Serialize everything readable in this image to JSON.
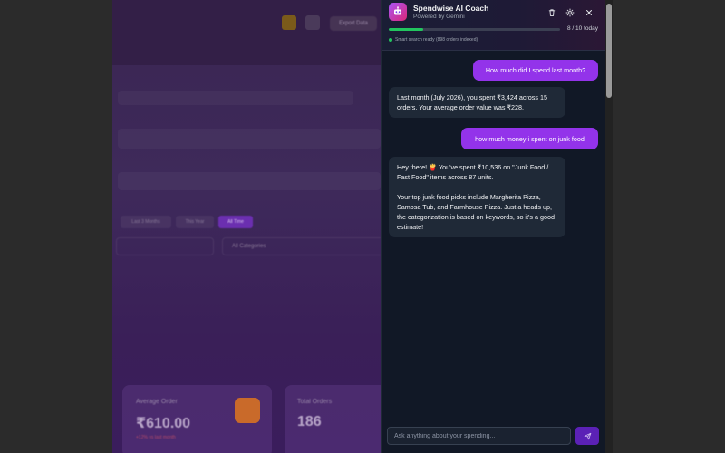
{
  "background": {
    "topbar_button_label": "Export Data",
    "tabs": [
      "Last 3 Months",
      "This Year",
      "All Time"
    ],
    "filter_value": "All Categories",
    "cards": [
      {
        "label": "Average Order",
        "value": "₹610.00",
        "sub": "+12% vs last month"
      },
      {
        "label": "Total Orders",
        "value": "186"
      }
    ]
  },
  "chat": {
    "title": "Spendwise AI Coach",
    "subtitle": "Powered by Gemini",
    "usage": {
      "used": 2,
      "limit": 10,
      "label": "8 / 10 today"
    },
    "index_status": "Smart search ready (898 orders indexed)",
    "messages": [
      {
        "role": "user",
        "text": "How much did I spend last month?"
      },
      {
        "role": "bot",
        "paragraphs": [
          "Last month (July 2026), you spent ₹3,424 across 15 orders. Your average order value was ₹228."
        ]
      },
      {
        "role": "user",
        "text": "how much money i spent on junk food"
      },
      {
        "role": "bot",
        "paragraphs": [
          "Hey there! 🍟 You've spent ₹10,536 on \"Junk Food / Fast Food\" items across 87 units.",
          "Your top junk food picks include Margherita Pizza, Samosa Tub, and Farmhouse Pizza. Just a heads up, the categorization is based on keywords, so it's a good estimate!"
        ]
      }
    ],
    "input_placeholder": "Ask anything about your spending..."
  },
  "colors": {
    "accent": "#9333ea",
    "progress": "#22c55e",
    "panel_bg": "#111826",
    "bubble_bot": "#1f2937"
  }
}
